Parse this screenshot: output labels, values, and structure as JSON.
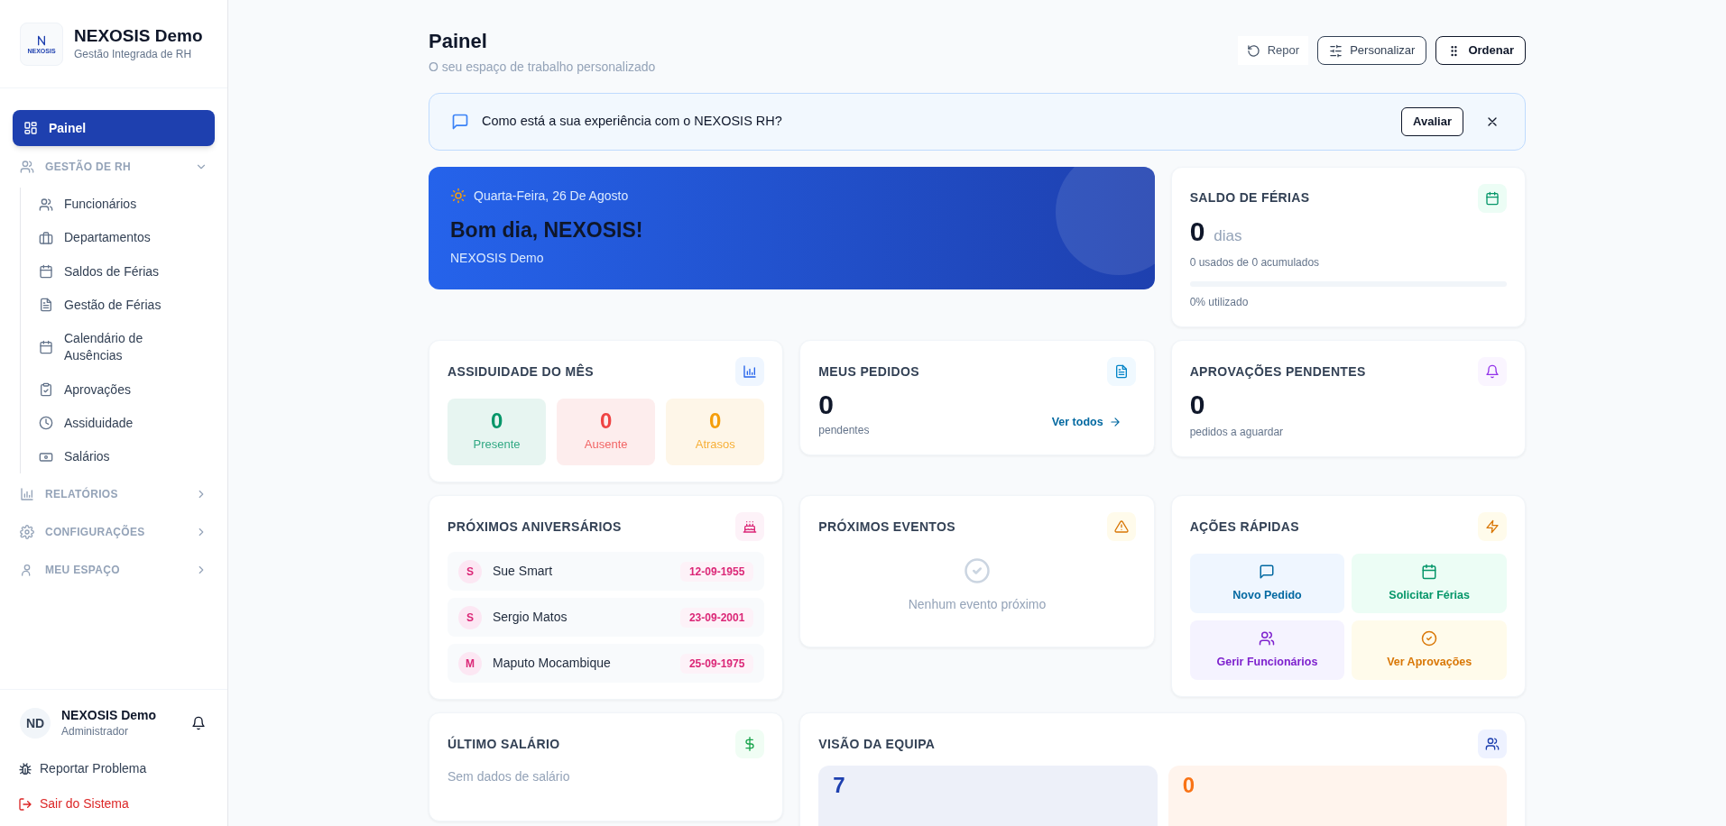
{
  "sidebar": {
    "brand": {
      "logo_text": "NEXOSIS",
      "title": "NEXOSIS Demo",
      "subtitle": "Gestão Integrada de RH"
    },
    "items": [
      {
        "kind": "link",
        "label": "Painel",
        "selected": true
      },
      {
        "kind": "section",
        "label": "GESTÃO DE RH",
        "expanded": true,
        "children": [
          {
            "label": "Funcionários",
            "selected": false
          },
          {
            "label": "Departamentos",
            "selected": false
          },
          {
            "label": "Saldos de Férias",
            "selected": false
          },
          {
            "label": "Gestão de Férias",
            "selected": false
          },
          {
            "label": "Calendário de Ausências",
            "selected": false
          },
          {
            "label": "Aprovações",
            "selected": false
          },
          {
            "label": "Assiduidade",
            "selected": false
          },
          {
            "label": "Salários",
            "selected": false
          }
        ]
      },
      {
        "kind": "section",
        "label": "RELATÓRIOS",
        "expanded": false
      },
      {
        "kind": "section",
        "label": "CONFIGURAÇÕES",
        "expanded": false
      },
      {
        "kind": "section",
        "label": "MEU ESPAÇO",
        "expanded": false
      }
    ],
    "user": {
      "initials": "ND",
      "name": "NEXOSIS Demo",
      "role": "Administrador"
    },
    "footer_links": [
      {
        "label": "Reportar Problema",
        "kind": "default"
      },
      {
        "label": "Sair do Sistema",
        "kind": "danger"
      }
    ]
  },
  "header": {
    "title": "Painel",
    "subtitle": "O seu espaço de trabalho personalizado",
    "actions": [
      {
        "label": "Repor",
        "kind": "ghost"
      },
      {
        "label": "Personalizar",
        "kind": "outline"
      },
      {
        "label": "Ordenar",
        "kind": "strong"
      }
    ]
  },
  "feedback": {
    "text": "Como está a sua experiência com o NEXOSIS RH?",
    "button": "Avaliar"
  },
  "hero": {
    "date": "Quarta-Feira, 26 De Agosto",
    "greeting": "Bom dia, NEXOSIS!",
    "company": "NEXOSIS Demo"
  },
  "widgets": [
    {
      "kind": "balance",
      "title": "SALDO DE FÉRIAS",
      "value": "0",
      "unit": "dias",
      "detail": "0 usados de 0 acumulados",
      "level": 0,
      "usage": "0% utilizado"
    },
    {
      "kind": "attendance",
      "title": "ASSIDUIDADE DO MÊS",
      "stats": [
        {
          "value": "0",
          "label": "Presente",
          "color": "#059669"
        },
        {
          "value": "0",
          "label": "Ausente",
          "color": "#ef4444"
        },
        {
          "value": "0",
          "label": "Atrasos",
          "color": "#f59e0b"
        }
      ]
    },
    {
      "kind": "requests",
      "title": "MEUS PEDIDOS",
      "value": "0",
      "caption": "pendentes",
      "link": "Ver todos"
    },
    {
      "kind": "approvals",
      "title": "APROVAÇÕES PENDENTES",
      "value": "0",
      "caption": "pedidos a aguardar"
    },
    {
      "kind": "birthdays",
      "title": "PRÓXIMOS ANIVERSÁRIOS",
      "people": [
        {
          "initial": "S",
          "name": "Sue Smart",
          "date": "12-09-1955"
        },
        {
          "initial": "S",
          "name": "Sergio Matos",
          "date": "23-09-2001"
        },
        {
          "initial": "M",
          "name": "Maputo Mocambique",
          "date": "25-09-1975"
        }
      ]
    },
    {
      "kind": "events",
      "title": "PRÓXIMOS EVENTOS",
      "empty": "Nenhum evento próximo"
    },
    {
      "kind": "quick_actions",
      "title": "AÇÕES RÁPIDAS",
      "actions": [
        {
          "label": "Novo Pedido",
          "color": "#0369a1"
        },
        {
          "label": "Solicitar Férias",
          "color": "#059669"
        },
        {
          "label": "Gerir Funcionários",
          "color": "#7e22ce"
        },
        {
          "label": "Ver Aprovações",
          "color": "#d97706"
        }
      ]
    },
    {
      "kind": "salary",
      "title": "ÚLTIMO SALÁRIO",
      "empty": "Sem dados de salário"
    },
    {
      "kind": "team",
      "title": "VISÃO DA EQUIPA",
      "stats": [
        {
          "value": "7",
          "color": "#1e40af"
        },
        {
          "value": "0",
          "color": "#f97316"
        }
      ]
    }
  ]
}
